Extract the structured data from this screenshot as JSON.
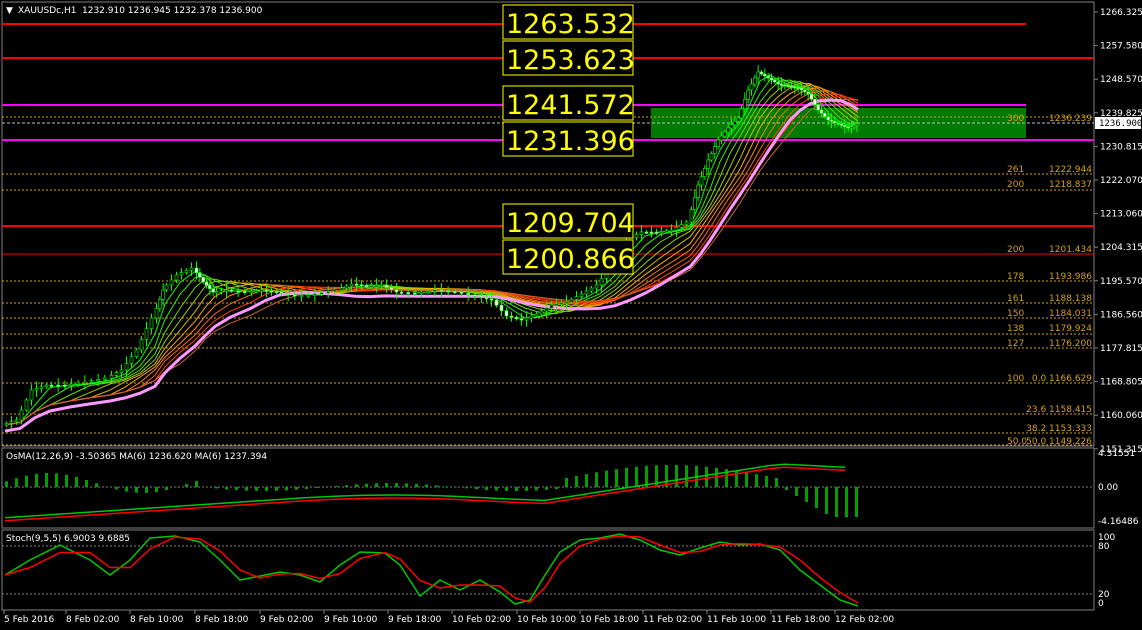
{
  "header": {
    "arrow_icon": "triangle-down-icon",
    "symbol": "XAUUSDc,H1",
    "ohlc": "1232.910 1236.945 1232.378 1236.900"
  },
  "price_axis": {
    "ticks": [
      "1266.325",
      "1257.580",
      "1248.570",
      "1239.825",
      "1230.815",
      "1222.070",
      "1213.060",
      "1204.315",
      "1195.570",
      "1186.560",
      "1177.815",
      "1168.805",
      "1160.060",
      "1151.315"
    ],
    "current": "1236.900"
  },
  "level_boxes": [
    "1263.532",
    "1253.623",
    "1241.572",
    "1231.396",
    "1209.704",
    "1200.866"
  ],
  "fib_labels": [
    {
      "ratio": "300",
      "value": "1236.239"
    },
    {
      "ratio": "261",
      "value": "1222.944"
    },
    {
      "ratio": "200",
      "value": "1218.837"
    },
    {
      "ratio": "200",
      "value": "1201.434"
    },
    {
      "ratio": "178",
      "value": "1193.986"
    },
    {
      "ratio": "161",
      "value": "1188.138"
    },
    {
      "ratio": "150",
      "value": "1184.031"
    },
    {
      "ratio": "138",
      "value": "1179.924"
    },
    {
      "ratio": "127",
      "value": "1176.200"
    },
    {
      "ratio": "100",
      "value": "0.0  1166.629"
    },
    {
      "ratio": "",
      "value": "23.6  1158.415"
    },
    {
      "ratio": "",
      "value": "38.2  1153.333"
    },
    {
      "ratio": "50.0",
      "value": "50.0  1149.226"
    }
  ],
  "osma": {
    "label": "OsMA(12,26,9) -3.50365  MA(6) 1236.620  MA(6) 1237.394",
    "ticks": [
      "4.31551",
      "0.00",
      "-4.16486"
    ]
  },
  "stoch": {
    "label": "Stoch(9,5,5) 6.9003 9.6885",
    "ticks": [
      "100",
      "80",
      "20",
      "0"
    ]
  },
  "time_axis": [
    "5 Feb 2016",
    "8 Feb 02:00",
    "8 Feb 10:00",
    "8 Feb 18:00",
    "9 Feb 02:00",
    "9 Feb 10:00",
    "9 Feb 18:00",
    "10 Feb 02:00",
    "10 Feb 10:00",
    "10 Feb 18:00",
    "11 Feb 02:00",
    "11 Feb 10:00",
    "11 Feb 18:00",
    "12 Feb 02:00"
  ],
  "colors": {
    "background": "#000000",
    "resistance": "#ff0000",
    "magenta": "#ff00ff",
    "zone": "#007a00",
    "box_text": "#ffff00",
    "fib": "#d4a017",
    "candle": "#00ff00",
    "ma_slow": "#ff99ff",
    "osma_bar": "#00a000",
    "stoch_main": "#00c800",
    "stoch_signal": "#ff0000"
  }
}
